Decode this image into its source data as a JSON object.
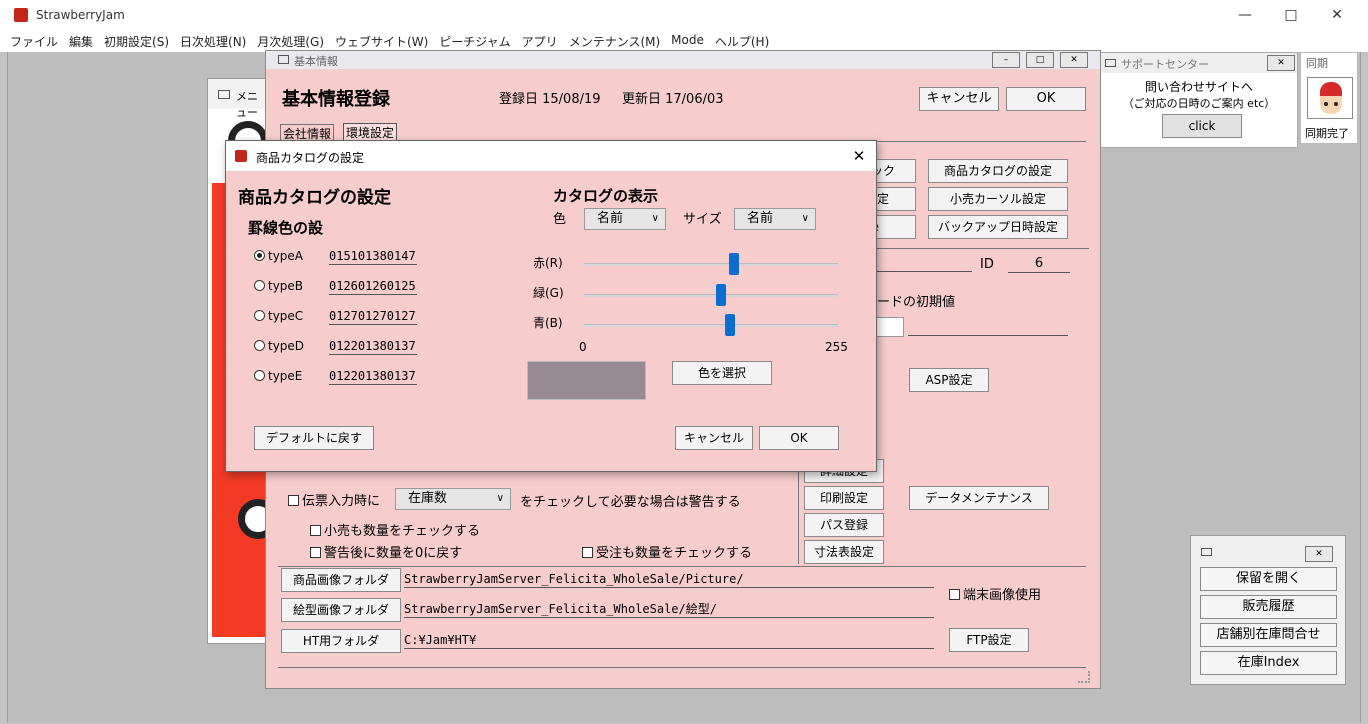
{
  "app": {
    "title": "StrawberryJam"
  },
  "menubar": [
    "ファイル",
    "編集",
    "初期設定(S)",
    "日次処理(N)",
    "月次処理(G)",
    "ウェブサイト(W)",
    "ピーチジャム",
    "アプリ",
    "メンテナンス(M)",
    "Mode",
    "ヘルプ(H)"
  ],
  "menu_window": {
    "title": "メニュー"
  },
  "kihon": {
    "window_title": "基本情報",
    "heading": "基本情報登録",
    "reg_date": "登録日 15/08/19",
    "upd_date": "更新日 17/06/03",
    "cancel": "キャンセル",
    "ok": "OK",
    "tabs": [
      "会社情報",
      "環境設定"
    ],
    "right_buttons": [
      "商品カタログの設定",
      "小売カーソル設定",
      "バックアップ日時設定"
    ],
    "partial_buttons": [
      "ック",
      "定",
      "e"
    ],
    "id_label": "ID",
    "id_value": "6",
    "code_label": "コードの初期値",
    "asp": "ASP設定",
    "detail_btn": "詳細設定",
    "print_btn": "印刷設定",
    "path_btn": "パス登録",
    "size_btn": "寸法表設定",
    "data_maint": "データメンテナンス",
    "check_slip": "伝票入力時に",
    "stock_select": "在庫数",
    "check_slip_tail": "をチェックして必要な場合は警告する",
    "check_retail": "小売も数量をチェックする",
    "check_reset": "警告後に数量を0に戻す",
    "check_order": "受注も数量をチェックする",
    "img_folder_btn": "商品画像フォルダ",
    "img_folder_path": "StrawberryJamServer_Felicita_WholeSale/Picture/",
    "pattern_folder_btn": "絵型画像フォルダ",
    "pattern_folder_path": "StrawberryJamServer_Felicita_WholeSale/絵型/",
    "ht_folder_btn": "HT用フォルダ",
    "ht_folder_path": "C:¥Jam¥HT¥",
    "terminal_img": "端末画像使用",
    "ftp": "FTP設定"
  },
  "support": {
    "title": "サポートセンター",
    "line1": "問い合わせサイトへ",
    "line2": "（ご対応の日時のご案内 etc）",
    "click": "click"
  },
  "sync": {
    "title": "同期",
    "status": "同期完了"
  },
  "quick": {
    "buttons": [
      "保留を開く",
      "販売履歴",
      "店舗別在庫問合せ",
      "在庫Index"
    ]
  },
  "dialog": {
    "title": "商品カタログの設定",
    "heading": "商品カタログの設定",
    "border_heading": "罫線色の設",
    "types": [
      {
        "label": "typeA",
        "value": "015101380147",
        "selected": true
      },
      {
        "label": "typeB",
        "value": "012601260125",
        "selected": false
      },
      {
        "label": "typeC",
        "value": "012701270127",
        "selected": false
      },
      {
        "label": "typeD",
        "value": "012201380137",
        "selected": false
      },
      {
        "label": "typeE",
        "value": "012201380137",
        "selected": false
      }
    ],
    "display_heading": "カタログの表示",
    "color_label": "色",
    "color_select": "名前",
    "size_label": "サイズ",
    "size_select": "名前",
    "red_label": "赤(R)",
    "green_label": "緑(G)",
    "blue_label": "青(B)",
    "red_value": 151,
    "green_value": 138,
    "blue_value": 147,
    "range_min": "0",
    "range_max": "255",
    "swatch_color": "#978a93",
    "choose_color": "色を選択",
    "default_btn": "デフォルトに戻す",
    "cancel": "キャンセル",
    "ok": "OK"
  }
}
